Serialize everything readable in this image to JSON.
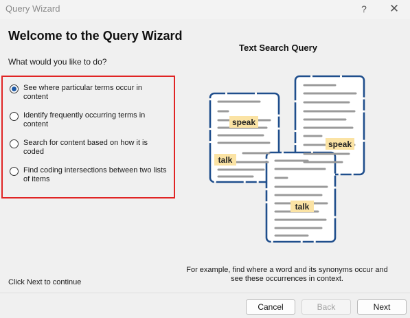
{
  "window": {
    "title": "Query Wizard",
    "help_glyph": "?",
    "close_glyph": "✕"
  },
  "main": {
    "heading": "Welcome to the Query Wizard",
    "prompt": "What would you like to do?",
    "options": [
      {
        "label": "See where particular terms occur in content",
        "checked": true
      },
      {
        "label": "Identify frequently occurring terms in content",
        "checked": false
      },
      {
        "label": "Search for content based on how it is coded",
        "checked": false
      },
      {
        "label": "Find coding intersections between two lists of items",
        "checked": false
      }
    ],
    "hint": "Click Next to continue"
  },
  "illustration": {
    "title": "Text Search Query",
    "tags": [
      "speak",
      "talk",
      "speak",
      "talk"
    ],
    "caption": "For example, find where a word and its synonyms occur and see these occurrences in context.",
    "colors": {
      "border": "#1f4e8c",
      "highlight": "#fbe3a4",
      "line": "#9a9a9a"
    }
  },
  "footer": {
    "cancel": "Cancel",
    "back": "Back",
    "next": "Next"
  }
}
